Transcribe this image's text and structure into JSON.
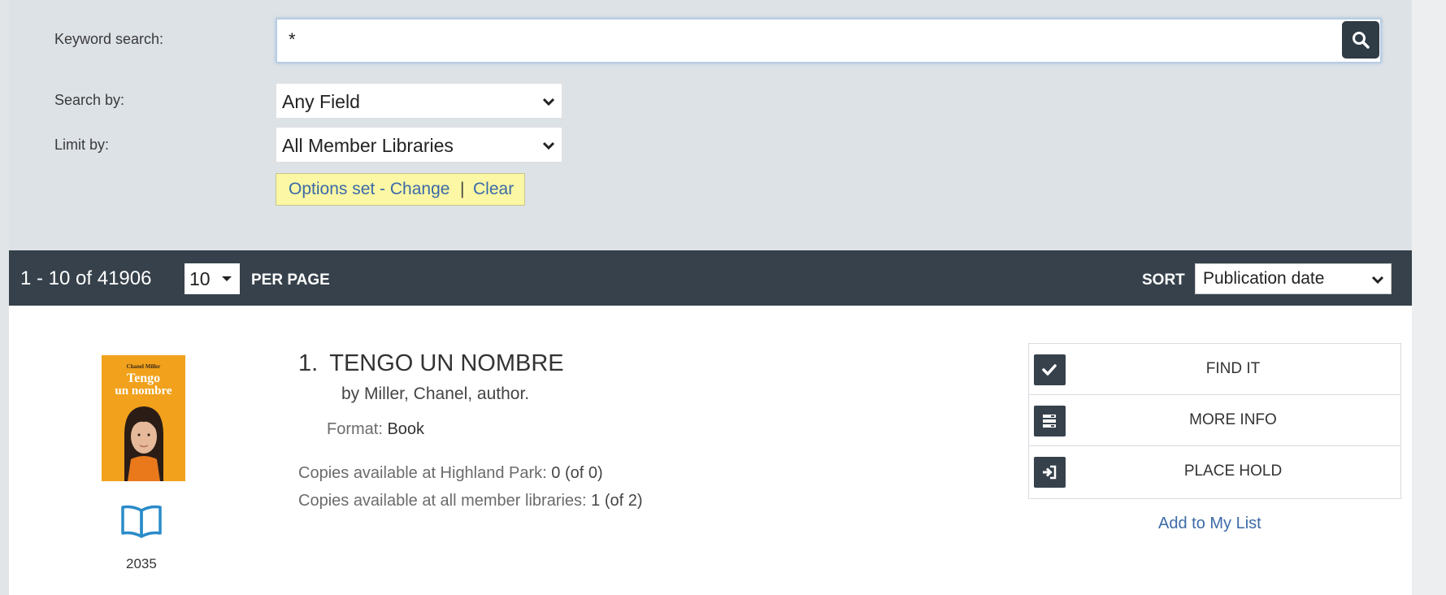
{
  "search": {
    "keyword_label": "Keyword search:",
    "keyword_value": "*",
    "search_by_label": "Search by:",
    "search_by_value": "Any Field",
    "limit_by_label": "Limit by:",
    "limit_by_value": "All Member Libraries",
    "options_text": "Options set - Change",
    "options_separator": "|",
    "clear_text": "Clear"
  },
  "results_bar": {
    "count": "1 - 10 of 41906",
    "per_page_value": "10",
    "per_page_label": "PER PAGE",
    "sort_label": "SORT",
    "sort_value": "Publication date"
  },
  "result": {
    "number": "1.",
    "title": "TENGO UN NOMBRE",
    "author": "by Miller, Chanel, author.",
    "format_label": "Format:",
    "format_value": "Book",
    "copies_local_label": "Copies available at Highland Park:",
    "copies_local_value": "0 (of 0)",
    "copies_all_label": "Copies available at all member libraries:",
    "copies_all_value": "1 (of 2)",
    "year": "2035",
    "cover": {
      "author": "Chanel Miller",
      "title_line1": "Tengo",
      "title_line2": "un nombre"
    },
    "format_icon": "open-book-icon"
  },
  "actions": {
    "find_it": "FIND IT",
    "more_info": "MORE INFO",
    "place_hold": "PLACE HOLD",
    "add_to_list": "Add to My List"
  },
  "colors": {
    "panel": "#dde2e7",
    "bar": "#36414b",
    "link": "#3c6ba6",
    "highlight": "#fbf7a4",
    "cover": "#f1a11b",
    "book_icon": "#2a8bc9"
  }
}
